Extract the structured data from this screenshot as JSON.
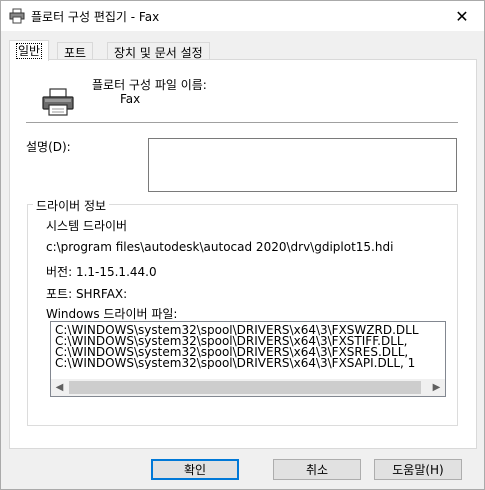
{
  "window": {
    "title": "플로터 구성 편집기 - Fax",
    "close_glyph": "✕"
  },
  "tabs": [
    {
      "label": "일반",
      "active": true
    },
    {
      "label": "포트",
      "active": false
    },
    {
      "label": "장치 및 문서 설정",
      "active": false
    }
  ],
  "general": {
    "file_name_label": "플로터 구성 파일 이름:",
    "file_name_value": "Fax",
    "description_label": "설명(D):",
    "description_value": "",
    "driver_group": {
      "title": "드라이버 정보",
      "system_driver_label": "시스템 드라이버",
      "driver_path": "c:\\program files\\autodesk\\autocad 2020\\drv\\gdiplot15.hdi",
      "version": "버전: 1.1-15.1.44.0",
      "port": "포트: SHRFAX:",
      "windows_driver_label": "Windows 드라이버 파일:",
      "files": [
        "C:\\WINDOWS\\system32\\spool\\DRIVERS\\x64\\3\\FXSWZRD.DLL",
        "C:\\WINDOWS\\system32\\spool\\DRIVERS\\x64\\3\\FXSTIFF.DLL,",
        "C:\\WINDOWS\\system32\\spool\\DRIVERS\\x64\\3\\FXSRES.DLL,",
        "C:\\WINDOWS\\system32\\spool\\DRIVERS\\x64\\3\\FXSAPI.DLL, 1"
      ]
    }
  },
  "buttons": {
    "ok": "확인",
    "cancel": "취소",
    "help": "도움말(H)"
  },
  "colors": {
    "accent": "#0078d7"
  }
}
